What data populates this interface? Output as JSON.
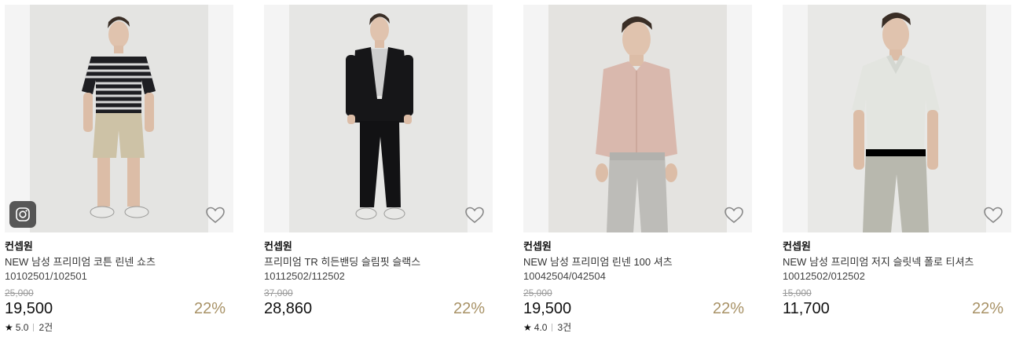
{
  "products": [
    {
      "brand": "컨셉원",
      "name": "NEW 남성 프리미엄 코튼 린넨 쇼츠",
      "code": "10102501/102501",
      "original_price": "25,000",
      "price": "19,500",
      "discount": "22%",
      "rating": "5.0",
      "review_count": "2건",
      "has_instagram_badge": true,
      "colors": {
        "top": "#1e1e22",
        "top_stripe": "#d8d8d8",
        "bottom": "#cdc2a6",
        "shoes": "#e8e8e6",
        "bg": "#e4e4e2"
      }
    },
    {
      "brand": "컨셉원",
      "name": "프리미엄 TR 히든밴딩 슬림핏 슬랙스",
      "code": "10112502/112502",
      "original_price": "37,000",
      "price": "28,860",
      "discount": "22%",
      "rating": null,
      "review_count": null,
      "has_instagram_badge": false,
      "colors": {
        "top": "#161618",
        "top_stripe": "#161618",
        "bottom": "#121214",
        "shoes": "#e8e8e6",
        "bg": "#e6e6e4"
      }
    },
    {
      "brand": "컨셉원",
      "name": "NEW 남성 프리미엄 린넨 100 셔츠",
      "code": "10042504/042504",
      "original_price": "25,000",
      "price": "19,500",
      "discount": "22%",
      "rating": "4.0",
      "review_count": "3건",
      "has_instagram_badge": false,
      "colors": {
        "top": "#d9b8ad",
        "top_stripe": "#d9b8ad",
        "bottom": "#bdbcb8",
        "shoes": "#bdbcb8",
        "bg": "#e4e3e0"
      }
    },
    {
      "brand": "컨셉원",
      "name": "NEW 남성 프리미엄 저지 슬릿넥 폴로 티셔츠",
      "code": "10012502/012502",
      "original_price": "15,000",
      "price": "11,700",
      "discount": "22%",
      "rating": null,
      "review_count": null,
      "has_instagram_badge": false,
      "colors": {
        "top": "#e3e5e0",
        "top_stripe": "#e3e5e0",
        "bottom": "#b8b8ae",
        "shoes": "#b8b8ae",
        "bg": "#e8e8e6"
      }
    }
  ],
  "icons": {
    "wishlist": "heart-outline-icon",
    "instagram": "instagram-icon",
    "rating": "star-icon"
  },
  "accent_discount_color": "#a89266"
}
